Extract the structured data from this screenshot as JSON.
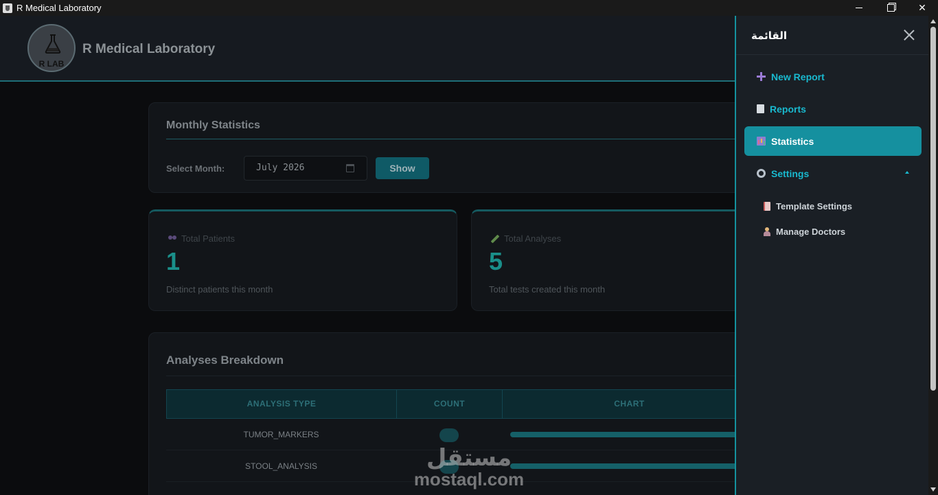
{
  "window": {
    "title": "R Medical Laboratory"
  },
  "header": {
    "app_title": "R Medical Laboratory",
    "logo_text": "R LAB"
  },
  "stats": {
    "title": "Monthly Statistics",
    "month_label": "Select Month:",
    "month_value": "July 2026",
    "show_label": "Show"
  },
  "cards": {
    "patients": {
      "label": "Total Patients",
      "value": "1",
      "desc": "Distinct patients this month"
    },
    "analyses": {
      "label": "Total Analyses",
      "value": "5",
      "desc": "Total tests created this month"
    }
  },
  "breakdown": {
    "title": "Analyses Breakdown",
    "columns": [
      "ANALYSIS TYPE",
      "COUNT",
      "CHART"
    ],
    "rows": [
      {
        "type": "TUMOR_MARKERS",
        "count": "",
        "bar_fraction": 1.0
      },
      {
        "type": "STOOL_ANALYSIS",
        "count": "",
        "bar_fraction": 1.0
      }
    ]
  },
  "drawer": {
    "title": "القائمة",
    "items": [
      {
        "label": "New Report",
        "icon": "plus-icon"
      },
      {
        "label": "Reports",
        "icon": "document-icon"
      },
      {
        "label": "Statistics",
        "icon": "chart-icon",
        "active": true
      },
      {
        "label": "Settings",
        "icon": "gear-icon",
        "expanded": true
      }
    ],
    "sub_items": [
      {
        "label": "Template Settings",
        "icon": "template-icon"
      },
      {
        "label": "Manage Doctors",
        "icon": "doctor-icon"
      }
    ]
  },
  "watermark": {
    "ar": "مستقل",
    "en": "mostaql.com"
  },
  "colors": {
    "accent": "#15909f",
    "value": "#1a8f8a",
    "header_border": "#1e6e78"
  }
}
